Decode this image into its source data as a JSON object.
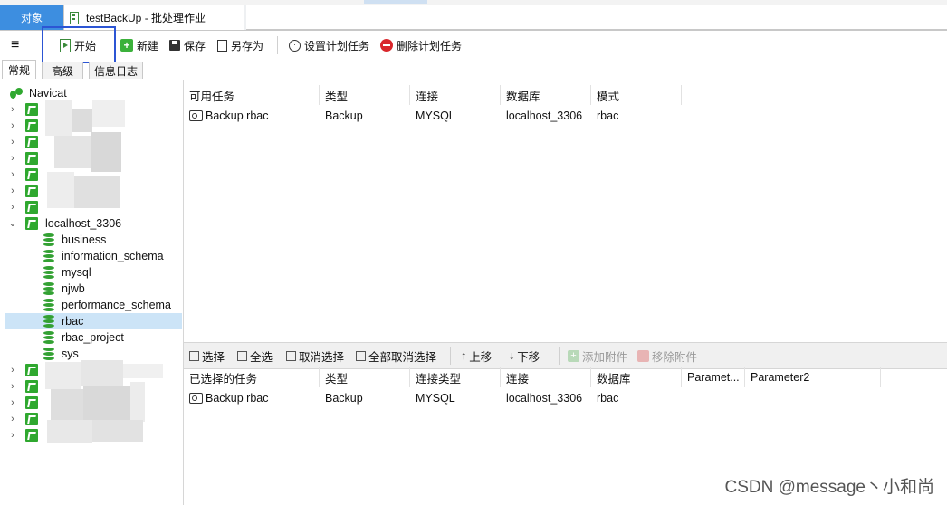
{
  "tabs": {
    "objects": "对象",
    "job": "testBackUp - 批处理作业"
  },
  "toolbar": {
    "start": "开始",
    "new": "新建",
    "save": "保存",
    "save_as": "另存为",
    "schedule": "设置计划任务",
    "delete_schedule": "删除计划任务"
  },
  "subtabs": [
    "常规",
    "高级",
    "信息日志"
  ],
  "tree": {
    "root": "Navicat",
    "connection": "localhost_3306",
    "databases": [
      "business",
      "information_schema",
      "mysql",
      "njwb",
      "performance_schema",
      "rbac",
      "rbac_project",
      "sys"
    ],
    "selected": "rbac"
  },
  "available": {
    "headers": [
      "可用任务",
      "类型",
      "连接",
      "数据库",
      "模式"
    ],
    "rows": [
      [
        "Backup rbac",
        "Backup",
        "MYSQL",
        "localhost_3306",
        "rbac"
      ]
    ]
  },
  "midbar": {
    "select": "选择",
    "select_all": "全选",
    "deselect": "取消选择",
    "deselect_all": "全部取消选择",
    "move_up": "上移",
    "move_down": "下移",
    "add_attach": "添加附件",
    "remove_attach": "移除附件"
  },
  "selected": {
    "headers": [
      "已选择的任务",
      "类型",
      "连接类型",
      "连接",
      "数据库",
      "Paramet...",
      "Parameter2"
    ],
    "rows": [
      [
        "Backup rbac",
        "Backup",
        "MYSQL",
        "localhost_3306",
        "rbac"
      ]
    ]
  },
  "watermark": "CSDN @message丶小和尚",
  "colors": {
    "accent": "#3d8ee0",
    "selection": "#cce4f7",
    "highlight_box": "#2c55d4",
    "db_green": "#33a133"
  }
}
